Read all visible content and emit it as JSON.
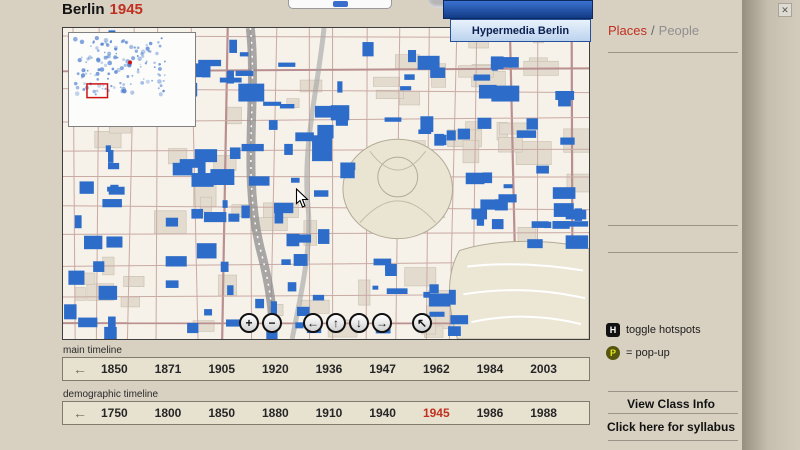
{
  "header": {
    "title": "Berlin",
    "year": "1945",
    "close": "✕"
  },
  "popup": {
    "title": "Hypermedia Berlin"
  },
  "map_controls": {
    "zoom_in": "+",
    "zoom_out": "−",
    "pan_left": "←",
    "pan_up": "↑",
    "pan_down": "↓",
    "pan_right": "→",
    "pan_mode": "↖"
  },
  "sidebar": {
    "places": "Places",
    "separator": "/",
    "people": "People",
    "hotspot_icon": "H",
    "hotspot_label": "toggle hotspots",
    "popup_icon": "P",
    "popup_label": "= pop-up",
    "class_info": "View Class Info",
    "syllabus": "Click here for syllabus"
  },
  "timelines": {
    "main": {
      "label": "main timeline",
      "back": "←",
      "years": [
        "1850",
        "1871",
        "1905",
        "1920",
        "1936",
        "1947",
        "1962",
        "1984",
        "2003"
      ]
    },
    "demographic": {
      "label": "demographic timeline",
      "back": "←",
      "years": [
        "1750",
        "1800",
        "1850",
        "1880",
        "1910",
        "1940",
        "1945",
        "1986",
        "1988"
      ],
      "highlighted_year": "1945"
    }
  },
  "colors": {
    "accent_red": "#c03020",
    "building_blue": "#2d6cc8",
    "page_background": "#d8d1c2"
  }
}
